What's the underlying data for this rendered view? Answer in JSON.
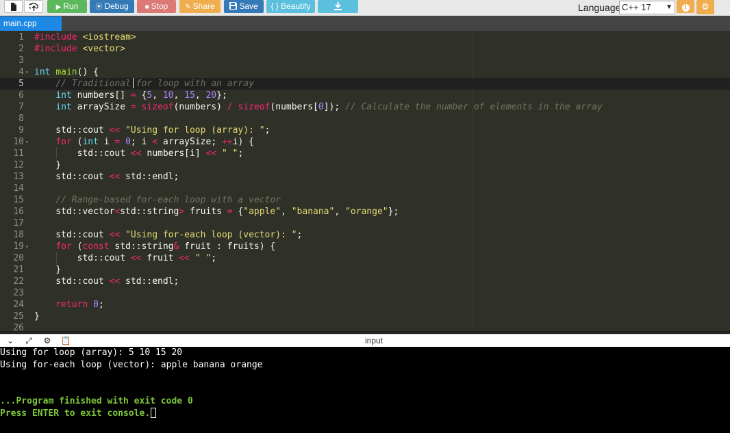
{
  "toolbar": {
    "run_label": "Run",
    "debug_label": "Debug",
    "stop_label": "Stop",
    "share_label": "Share",
    "save_label": "Save",
    "beautify_label": "{ } Beautify",
    "language_label": "Language",
    "language_value": "C++ 17"
  },
  "tabs": [
    {
      "label": "main.cpp"
    }
  ],
  "editor": {
    "lines": [
      {
        "n": "1",
        "html": "<span class='tk-pre'>#include</span> <span class='tk-str'>&lt;iostream&gt;</span>"
      },
      {
        "n": "2",
        "html": "<span class='tk-pre'>#include</span> <span class='tk-str'>&lt;vector&gt;</span>"
      },
      {
        "n": "3",
        "html": ""
      },
      {
        "n": "4",
        "fold": true,
        "html": "<span class='tk-type'>int</span> <span class='tk-fn'>main</span>() {"
      },
      {
        "n": "5",
        "active": true,
        "html": "    <span class='tk-com'>// Traditional for loop with an array</span>"
      },
      {
        "n": "6",
        "html": "    <span class='tk-type'>int</span> numbers[] <span class='tk-op'>=</span> {<span class='tk-num'>5</span>, <span class='tk-num'>10</span>, <span class='tk-num'>15</span>, <span class='tk-num'>20</span>};"
      },
      {
        "n": "7",
        "html": "    <span class='tk-type'>int</span> arraySize <span class='tk-op'>=</span> <span class='tk-kw'>sizeof</span>(numbers) <span class='tk-op'>/</span> <span class='tk-kw'>sizeof</span>(numbers[<span class='tk-num'>0</span>]); <span class='tk-com'>// Calculate the number of elements in the array</span>"
      },
      {
        "n": "8",
        "html": ""
      },
      {
        "n": "9",
        "html": "    std::cout <span class='tk-op'>&lt;&lt;</span> <span class='tk-str'>\"Using for loop (array): \"</span>;"
      },
      {
        "n": "10",
        "fold": true,
        "html": "    <span class='tk-ctrl'>for</span> (<span class='tk-type'>int</span> i <span class='tk-op'>=</span> <span class='tk-num'>0</span>; i <span class='tk-op'>&lt;</span> arraySize; <span class='tk-op'>++</span>i) {"
      },
      {
        "n": "11",
        "html": "        std::cout <span class='tk-op'>&lt;&lt;</span> numbers[i] <span class='tk-op'>&lt;&lt;</span> <span class='tk-str'>\" \"</span>;"
      },
      {
        "n": "12",
        "html": "    }"
      },
      {
        "n": "13",
        "html": "    std::cout <span class='tk-op'>&lt;&lt;</span> std::endl;"
      },
      {
        "n": "14",
        "html": ""
      },
      {
        "n": "15",
        "html": "    <span class='tk-com'>// Range-based for-each loop with a vector</span>"
      },
      {
        "n": "16",
        "html": "    std::vector<span class='tk-op'>&lt;</span>std::string<span class='tk-op'>&gt;</span> fruits <span class='tk-op'>=</span> {<span class='tk-str'>\"apple\"</span>, <span class='tk-str'>\"banana\"</span>, <span class='tk-str'>\"orange\"</span>};"
      },
      {
        "n": "17",
        "html": ""
      },
      {
        "n": "18",
        "html": "    std::cout <span class='tk-op'>&lt;&lt;</span> <span class='tk-str'>\"Using for-each loop (vector): \"</span>;"
      },
      {
        "n": "19",
        "fold": true,
        "html": "    <span class='tk-ctrl'>for</span> (<span class='tk-kw'>const</span> std::string<span class='tk-op'>&amp;</span> fruit : fruits) {"
      },
      {
        "n": "20",
        "html": "        std::cout <span class='tk-op'>&lt;&lt;</span> fruit <span class='tk-op'>&lt;&lt;</span> <span class='tk-str'>\" \"</span>;"
      },
      {
        "n": "21",
        "html": "    }"
      },
      {
        "n": "22",
        "html": "    std::cout <span class='tk-op'>&lt;&lt;</span> std::endl;"
      },
      {
        "n": "23",
        "html": ""
      },
      {
        "n": "24",
        "html": "    <span class='tk-ctrl'>return</span> <span class='tk-num'>0</span>;"
      },
      {
        "n": "25",
        "html": "}"
      },
      {
        "n": "26",
        "html": ""
      }
    ]
  },
  "console_bar": {
    "input_label": "input"
  },
  "console": {
    "lines": [
      {
        "text": "Using for loop (array): 5 10 15 20",
        "green": false
      },
      {
        "text": "Using for-each loop (vector): apple banana orange",
        "green": false
      },
      {
        "text": "",
        "green": false
      },
      {
        "text": "",
        "green": false
      },
      {
        "text": "...Program finished with exit code 0",
        "green": true
      },
      {
        "text": "Press ENTER to exit console.",
        "green": true,
        "cursor": true
      }
    ]
  },
  "colors": {
    "run": "#5cb85c",
    "debug": "#337ab7",
    "stop": "#d9534f",
    "share": "#f0ad4e",
    "save": "#337ab7",
    "beautify": "#5bc0de",
    "tab_active": "#1e88e5",
    "editor_bg": "#2f3129",
    "console_bg": "#000000",
    "console_success": "#7ec83a"
  },
  "icons": [
    "new-file-icon",
    "upload-icon",
    "play-icon",
    "debug-icon",
    "stop-icon",
    "share-icon",
    "save-icon",
    "download-icon",
    "info-icon",
    "gear-icon",
    "chevron-down-icon",
    "expand-icon",
    "settings-icon",
    "paste-icon"
  ]
}
